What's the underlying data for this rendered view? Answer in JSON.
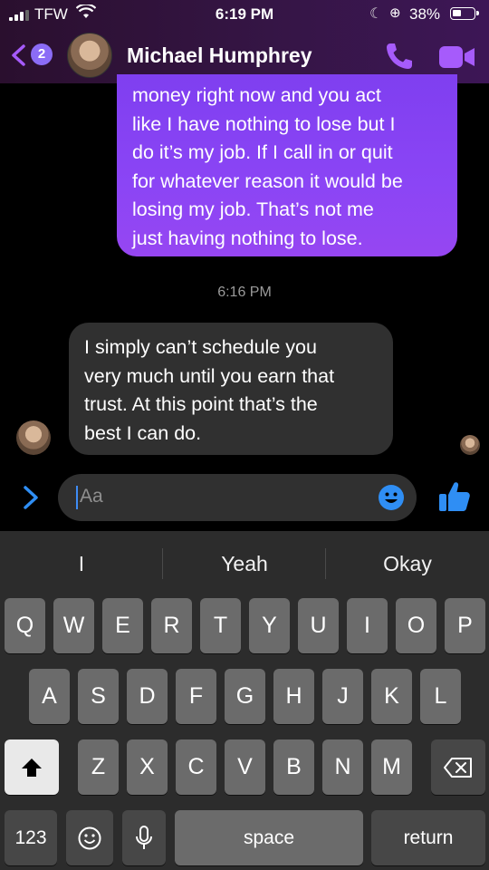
{
  "status_bar": {
    "carrier": "TFW",
    "time": "6:19 PM",
    "battery": "38%"
  },
  "header": {
    "back_badge": "2",
    "contact_name": "Michael Humphrey"
  },
  "messages": {
    "outgoing_1": [
      "money right now and you act",
      "like I have nothing to lose but I",
      "do it’s my job. If I call in or quit",
      "for whatever reason it would be",
      "losing my job. That’s not me",
      "just having nothing to lose."
    ],
    "timestamp": "6:16 PM",
    "incoming_1": [
      "I simply can’t schedule you",
      "very much until you earn that",
      "trust. At this point that’s the",
      "best I can do."
    ]
  },
  "composer": {
    "placeholder": "Aa"
  },
  "colors": {
    "accent": "#a65bfb",
    "outgoing_bubble": "#8b45f5",
    "incoming_bubble": "#303030",
    "like_icon": "#2f8ef4"
  },
  "keyboard": {
    "predictions": [
      "I",
      "Yeah",
      "Okay"
    ],
    "row1": [
      "Q",
      "W",
      "E",
      "R",
      "T",
      "Y",
      "U",
      "I",
      "O",
      "P"
    ],
    "row2": [
      "A",
      "S",
      "D",
      "F",
      "G",
      "H",
      "J",
      "K",
      "L"
    ],
    "row3": [
      "Z",
      "X",
      "C",
      "V",
      "B",
      "N",
      "M"
    ],
    "numbers_label": "123",
    "space_label": "space",
    "return_label": "return"
  }
}
